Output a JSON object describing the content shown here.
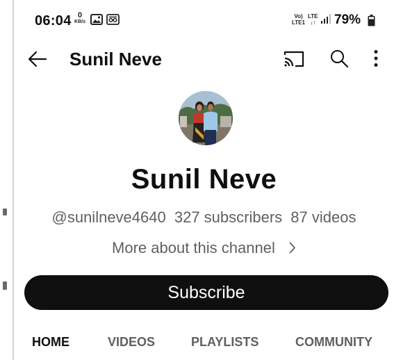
{
  "status_bar": {
    "time": "06:04",
    "net_speed_value": "0",
    "net_speed_unit": "KB/s",
    "volte_line1": "Vo)",
    "volte_line2": "LTE1",
    "lte_label": "LTE",
    "battery": "79%"
  },
  "app_bar": {
    "title": "Sunil Neve"
  },
  "channel": {
    "name": "Sunil Neve",
    "handle": "@sunilneve4640",
    "subscribers": "327 subscribers",
    "videos": "87 videos",
    "more_about": "More about this channel",
    "subscribe_label": "Subscribe"
  },
  "tabs": [
    {
      "label": "HOME",
      "active": true
    },
    {
      "label": "VIDEOS",
      "active": false
    },
    {
      "label": "PLAYLISTS",
      "active": false
    },
    {
      "label": "COMMUNITY",
      "active": false
    }
  ],
  "colors": {
    "text_primary": "#0f0f0f",
    "text_secondary": "#606060",
    "subscribe_bg": "#0f0f0f",
    "background": "#ffffff"
  }
}
